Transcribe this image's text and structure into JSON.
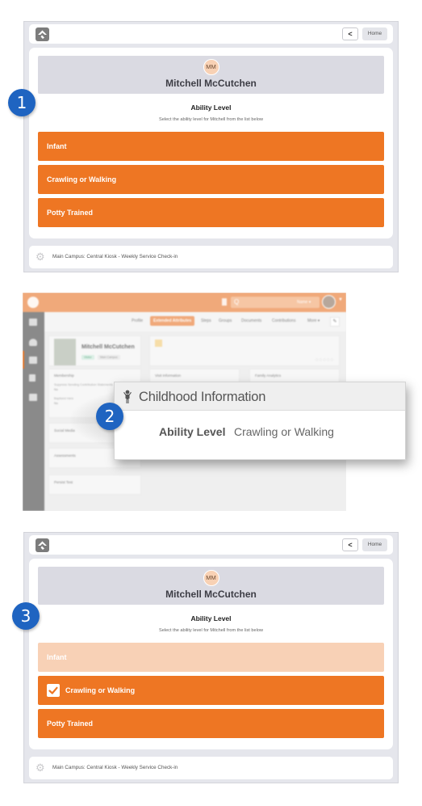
{
  "kiosk": {
    "back_label": "<",
    "home_label": "Home",
    "person": {
      "initials": "MM",
      "name": "Mitchell McCutchen"
    },
    "title": "Ability Level",
    "subtitle": "Select the ability level for Mitchell from the list below",
    "options": [
      {
        "label": "Infant"
      },
      {
        "label": "Crawling or Walking"
      },
      {
        "label": "Potty Trained"
      }
    ],
    "footer": "Main Campus: Central Kiosk - Weekly Service Check-in"
  },
  "state3": {
    "selected": "Crawling or Walking"
  },
  "steps": [
    "1",
    "2",
    "3"
  ],
  "rock_page": {
    "search_placeholder": "Q",
    "name_dropdown": "Name ▾",
    "tabs": [
      "Profile",
      "Extended Attributes",
      "Steps",
      "Groups",
      "Documents",
      "Contributions",
      "More ▾"
    ],
    "active_tab": "Extended Attributes",
    "person_name": "Mitchell McCutchen",
    "chips": [
      "Visitor",
      "Main Campus"
    ],
    "sections": {
      "membership": "Membership",
      "suppress_label": "Suppress Sending Contribution Statements",
      "suppress_value": "No",
      "baptized_label": "Baptized Here",
      "baptized_value": "No",
      "social_media": "Social Media",
      "assessments": "Assessments",
      "persist_test": "Persist Test",
      "visit_information": "Visit Information",
      "family_analytics": "Family Analytics"
    }
  },
  "childhood": {
    "title": "Childhood Information",
    "field_label": "Ability Level",
    "field_value": "Crawling or Walking"
  },
  "colors": {
    "accent": "#ee7623",
    "accent_faded": "#f8d1b6",
    "badge": "#1f64c1",
    "person_band": "#dadae2"
  }
}
